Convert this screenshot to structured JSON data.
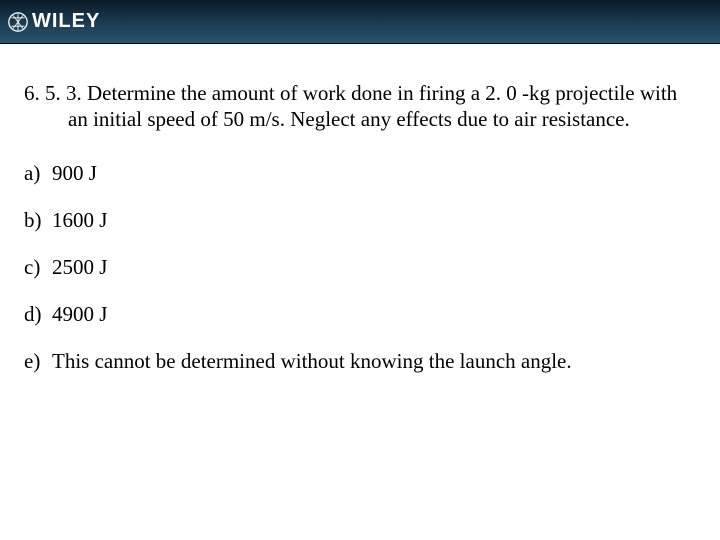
{
  "brand": {
    "name": "WILEY"
  },
  "question": {
    "number": "6. 5. 3.",
    "text": "Determine the amount of work done in firing a 2. 0 -kg projectile with an initial speed of 50 m/s.  Neglect any effects due to air resistance."
  },
  "options": [
    {
      "letter": "a)",
      "text": "900 J"
    },
    {
      "letter": "b)",
      "text": "1600 J"
    },
    {
      "letter": "c)",
      "text": "2500 J"
    },
    {
      "letter": "d)",
      "text": "4900 J"
    },
    {
      "letter": "e)",
      "text": "This cannot be determined without knowing the launch angle."
    }
  ]
}
